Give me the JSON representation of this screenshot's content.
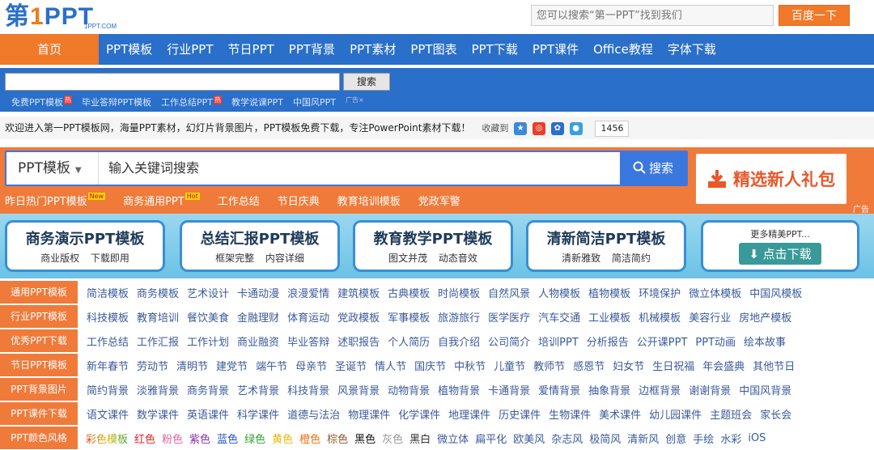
{
  "logo": {
    "main_a": "第",
    "main_one": "1",
    "main_b": "PPT",
    "sub": "1PPT.COM"
  },
  "top_search": {
    "placeholder": "您可以搜索“第一PPT”找到我们",
    "button": "百度一下"
  },
  "nav": {
    "home": "首页",
    "items": [
      "PPT模板",
      "行业PPT",
      "节日PPT",
      "PPT背景",
      "PPT素材",
      "PPT图表",
      "PPT下载",
      "PPT课件",
      "Office教程",
      "字体下载"
    ]
  },
  "site_search": {
    "button": "搜索",
    "links": [
      "免费PPT模板",
      "毕业答辩PPT模板",
      "工作总结PPT",
      "教学说课PPT",
      "中国风PPT"
    ],
    "hot_badge": "热",
    "ad_mark": "广告×"
  },
  "welcome": {
    "text": "欢迎进入第一PPT模板网，海量PPT素材，幻灯片背景图片，PPT模板免费下载，专注PowerPoint素材下载！",
    "fav_label": "收藏到",
    "count": "1456"
  },
  "big_search": {
    "category": "PPT模板",
    "placeholder": "输入关键词搜索",
    "button": "搜索"
  },
  "gift": {
    "label": "精选新人礼包"
  },
  "ad_tag": "广告",
  "hot_links": [
    {
      "label": "昨日热门PPT模板",
      "tag": "New"
    },
    {
      "label": "商务通用PPT",
      "tag": "Hot"
    },
    {
      "label": "工作总结",
      "tag": ""
    },
    {
      "label": "节日庆典",
      "tag": ""
    },
    {
      "label": "教育培训模板",
      "tag": ""
    },
    {
      "label": "党政军警",
      "tag": ""
    }
  ],
  "banners": [
    {
      "title": "商务演示PPT模板",
      "sub": "商业版权 下载即用"
    },
    {
      "title": "总结汇报PPT模板",
      "sub": "框架完整 内容详细"
    },
    {
      "title": "教育教学PPT模板",
      "sub": "图文并茂 动态音效"
    },
    {
      "title": "清新简洁PPT模板",
      "sub": "清新雅致 简洁简约"
    }
  ],
  "banner_more": {
    "title": "更多精美PPT...",
    "button": "点击下载"
  },
  "categories": [
    {
      "label": "通用PPT模板",
      "items": [
        "简洁模板",
        "商务模板",
        "艺术设计",
        "卡通动漫",
        "浪漫爱情",
        "建筑模板",
        "古典模板",
        "时尚模板",
        "自然风景",
        "人物模板",
        "植物模板",
        "环境保护",
        "微立体模板",
        "中国风模板"
      ]
    },
    {
      "label": "行业PPT模板",
      "items": [
        "科技模板",
        "教育培训",
        "餐饮美食",
        "金融理财",
        "体育运动",
        "党政模板",
        "军事模板",
        "旅游旅行",
        "医学医疗",
        "汽车交通",
        "工业模板",
        "机械模板",
        "美容行业",
        "房地产模板"
      ]
    },
    {
      "label": "优秀PPT下载",
      "items": [
        "工作总结",
        "工作汇报",
        "工作计划",
        "商业融资",
        "毕业答辩",
        "述职报告",
        "个人简历",
        "自我介绍",
        "公司简介",
        "培训PPT",
        "分析报告",
        "公开课PPT",
        "PPT动画",
        "绘本故事"
      ]
    },
    {
      "label": "节日PPT模板",
      "items": [
        "新年春节",
        "劳动节",
        "清明节",
        "建党节",
        "端午节",
        "母亲节",
        "圣诞节",
        "情人节",
        "国庆节",
        "中秋节",
        "儿童节",
        "教师节",
        "感恩节",
        "妇女节",
        "生日祝福",
        "年会盛典",
        "其他节日"
      ]
    },
    {
      "label": "PPT背景图片",
      "items": [
        "简约背景",
        "淡雅背景",
        "商务背景",
        "艺术背景",
        "科技背景",
        "风景背景",
        "动物背景",
        "植物背景",
        "卡通背景",
        "爱情背景",
        "抽象背景",
        "边框背景",
        "谢谢背景",
        "中国风背景"
      ]
    },
    {
      "label": "PPT课件下载",
      "items": [
        "语文课件",
        "数学课件",
        "英语课件",
        "科学课件",
        "道德与法治",
        "物理课件",
        "化学课件",
        "地理课件",
        "历史课件",
        "生物课件",
        "美术课件",
        "幼儿园课件",
        "主题班会",
        "家长会"
      ]
    },
    {
      "label": "PPT颜色风格",
      "items": [
        "彩色模板",
        "红色",
        "粉色",
        "紫色",
        "蓝色",
        "绿色",
        "黄色",
        "橙色",
        "棕色",
        "黑色",
        "灰色",
        "黑白",
        "微立体",
        "扁平化",
        "欧美风",
        "杂志风",
        "极简风",
        "清新风",
        "创意",
        "手绘",
        "水彩",
        "iOS"
      ]
    }
  ],
  "color_style_colors": [
    "#e8401a",
    "#e82020",
    "#e860a0",
    "#8a30b0",
    "#2050c8",
    "#30a030",
    "#e8b800",
    "#e87010",
    "#8a5a2a",
    "#111111",
    "#999999",
    "#333333"
  ]
}
